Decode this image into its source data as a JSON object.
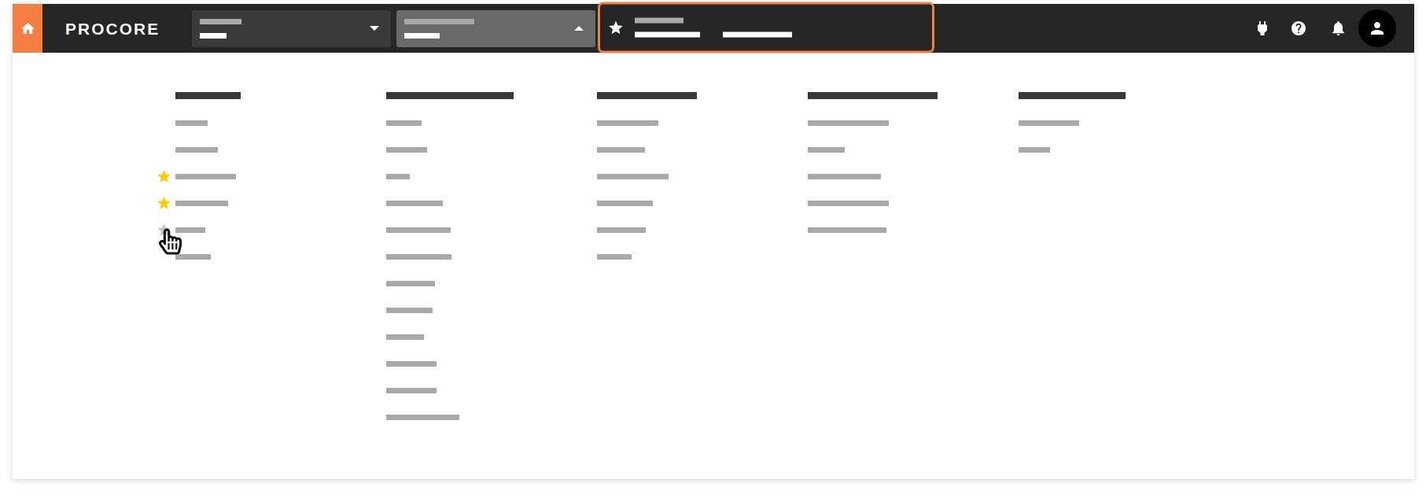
{
  "top_bar": {
    "logo": "PROCORE",
    "dropdowns": [
      {
        "expanded": false
      },
      {
        "expanded": true
      }
    ],
    "favorites_bar": {
      "highlighted": true
    }
  },
  "menu": {
    "columns": [
      {
        "items": [
          {
            "favorite": false,
            "hovered": false
          },
          {
            "favorite": false,
            "hovered": false
          },
          {
            "favorite": true,
            "hovered": false
          },
          {
            "favorite": true,
            "hovered": false
          },
          {
            "favorite": false,
            "hovered": true
          },
          {
            "favorite": false,
            "hovered": false
          }
        ]
      },
      {
        "items": [
          {
            "favorite": false,
            "hovered": false
          },
          {
            "favorite": false,
            "hovered": false
          },
          {
            "favorite": false,
            "hovered": false
          },
          {
            "favorite": false,
            "hovered": false
          },
          {
            "favorite": false,
            "hovered": false
          },
          {
            "favorite": false,
            "hovered": false
          },
          {
            "favorite": false,
            "hovered": false
          },
          {
            "favorite": false,
            "hovered": false
          },
          {
            "favorite": false,
            "hovered": false
          },
          {
            "favorite": false,
            "hovered": false
          },
          {
            "favorite": false,
            "hovered": false
          },
          {
            "favorite": false,
            "hovered": false
          }
        ]
      },
      {
        "items": [
          {
            "favorite": false,
            "hovered": false
          },
          {
            "favorite": false,
            "hovered": false
          },
          {
            "favorite": false,
            "hovered": false
          },
          {
            "favorite": false,
            "hovered": false
          },
          {
            "favorite": false,
            "hovered": false
          },
          {
            "favorite": false,
            "hovered": false
          }
        ]
      },
      {
        "items": [
          {
            "favorite": false,
            "hovered": false
          },
          {
            "favorite": false,
            "hovered": false
          },
          {
            "favorite": false,
            "hovered": false
          },
          {
            "favorite": false,
            "hovered": false
          },
          {
            "favorite": false,
            "hovered": false
          }
        ]
      },
      {
        "items": [
          {
            "favorite": false,
            "hovered": false
          },
          {
            "favorite": false,
            "hovered": false
          }
        ]
      }
    ]
  }
}
